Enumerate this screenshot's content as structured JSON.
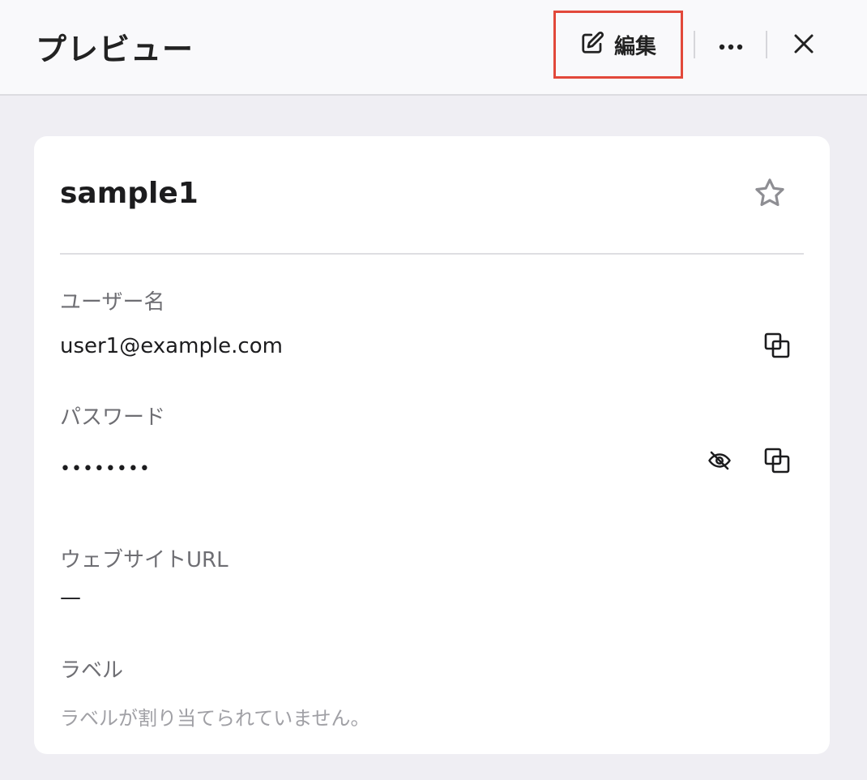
{
  "header": {
    "title": "プレビュー",
    "edit_label": "編集",
    "more_icon": "more-horizontal-icon",
    "close_icon": "close-icon"
  },
  "item": {
    "title": "sample1",
    "favorite_icon": "star-outline-icon"
  },
  "fields": {
    "username": {
      "label": "ユーザー名",
      "value": "user1@example.com"
    },
    "password": {
      "label": "パスワード",
      "value": "••••••••"
    },
    "website": {
      "label": "ウェブサイトURL",
      "value": "—"
    },
    "labels": {
      "label": "ラベル",
      "empty_text": "ラベルが割り当てられていません。"
    }
  },
  "colors": {
    "highlight_border": "#e2483a",
    "background": "#efeef3",
    "card": "#ffffff"
  }
}
